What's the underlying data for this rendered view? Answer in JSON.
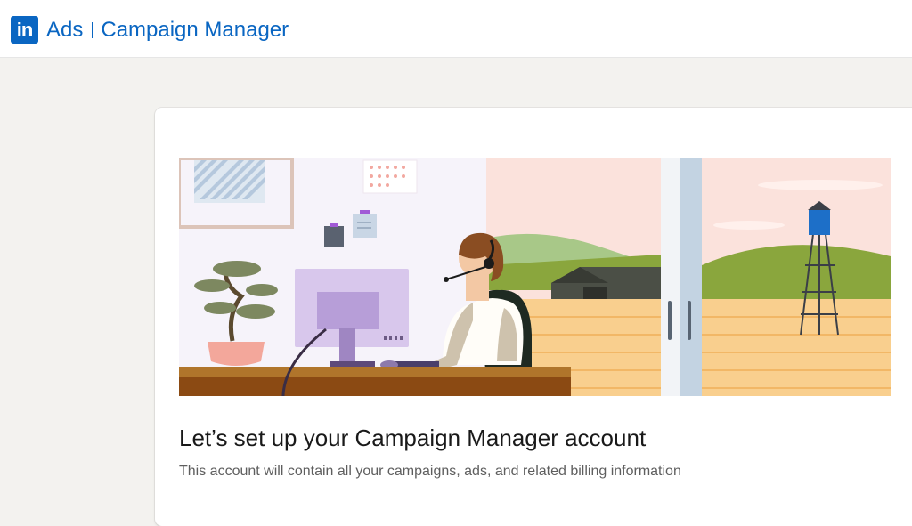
{
  "header": {
    "logo_text": "in",
    "brand_primary": "Ads",
    "brand_secondary": "Campaign Manager",
    "accent_color": "#0a66c2"
  },
  "main": {
    "title": "Let’s set up your Campaign Manager account",
    "subtitle": "This account will contain all your campaigns, ads, and related billing information"
  },
  "hero": {
    "illustration": "person-with-headset-at-desk-illustration"
  }
}
